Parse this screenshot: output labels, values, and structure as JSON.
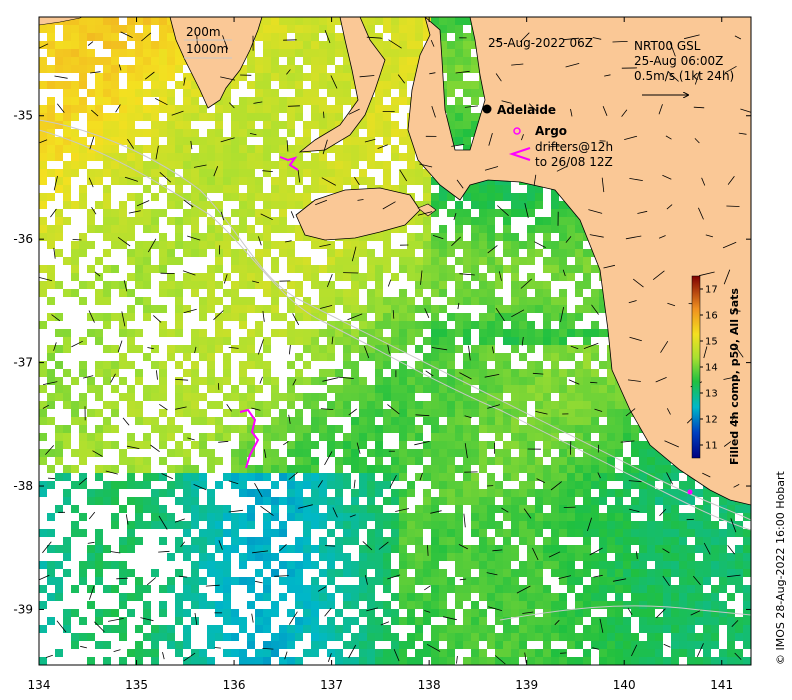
{
  "map": {
    "timestamp": "25-Aug-2022 06Z",
    "depth_labels": [
      "200m",
      "1000m"
    ],
    "product": {
      "line1": "NRT00 GSL",
      "line2": "25-Aug 06:00Z",
      "line3": "0.5m/s (1kt 24h)"
    },
    "city": {
      "name": "Adelaide",
      "lon": 138.6,
      "lat": -34.93
    },
    "legend": {
      "argo_label": "Argo",
      "drifters_line1": "drifters@12h",
      "drifters_line2": "to 26/08 12Z"
    },
    "colorbar": {
      "title": "Filled 4h comp, p50, All Sats",
      "ticks": [
        "11",
        "12",
        "13",
        "14",
        "15",
        "16",
        "17"
      ],
      "range": [
        10.5,
        17.5
      ]
    },
    "credit": "© IMOS 28-Aug-2022 16:00 Hobart",
    "x_ticks": [
      "134",
      "135",
      "136",
      "137",
      "138",
      "139",
      "140",
      "141"
    ],
    "y_ticks": [
      "-35",
      "-36",
      "-37",
      "-38",
      "-39"
    ],
    "x_range": [
      134,
      141.3
    ],
    "y_range": [
      -39.45,
      -34.2
    ],
    "colors": {
      "land": "#fac896",
      "coast": "#000000",
      "argo": "#ff00ff",
      "drifter": "#ff00ff"
    }
  }
}
